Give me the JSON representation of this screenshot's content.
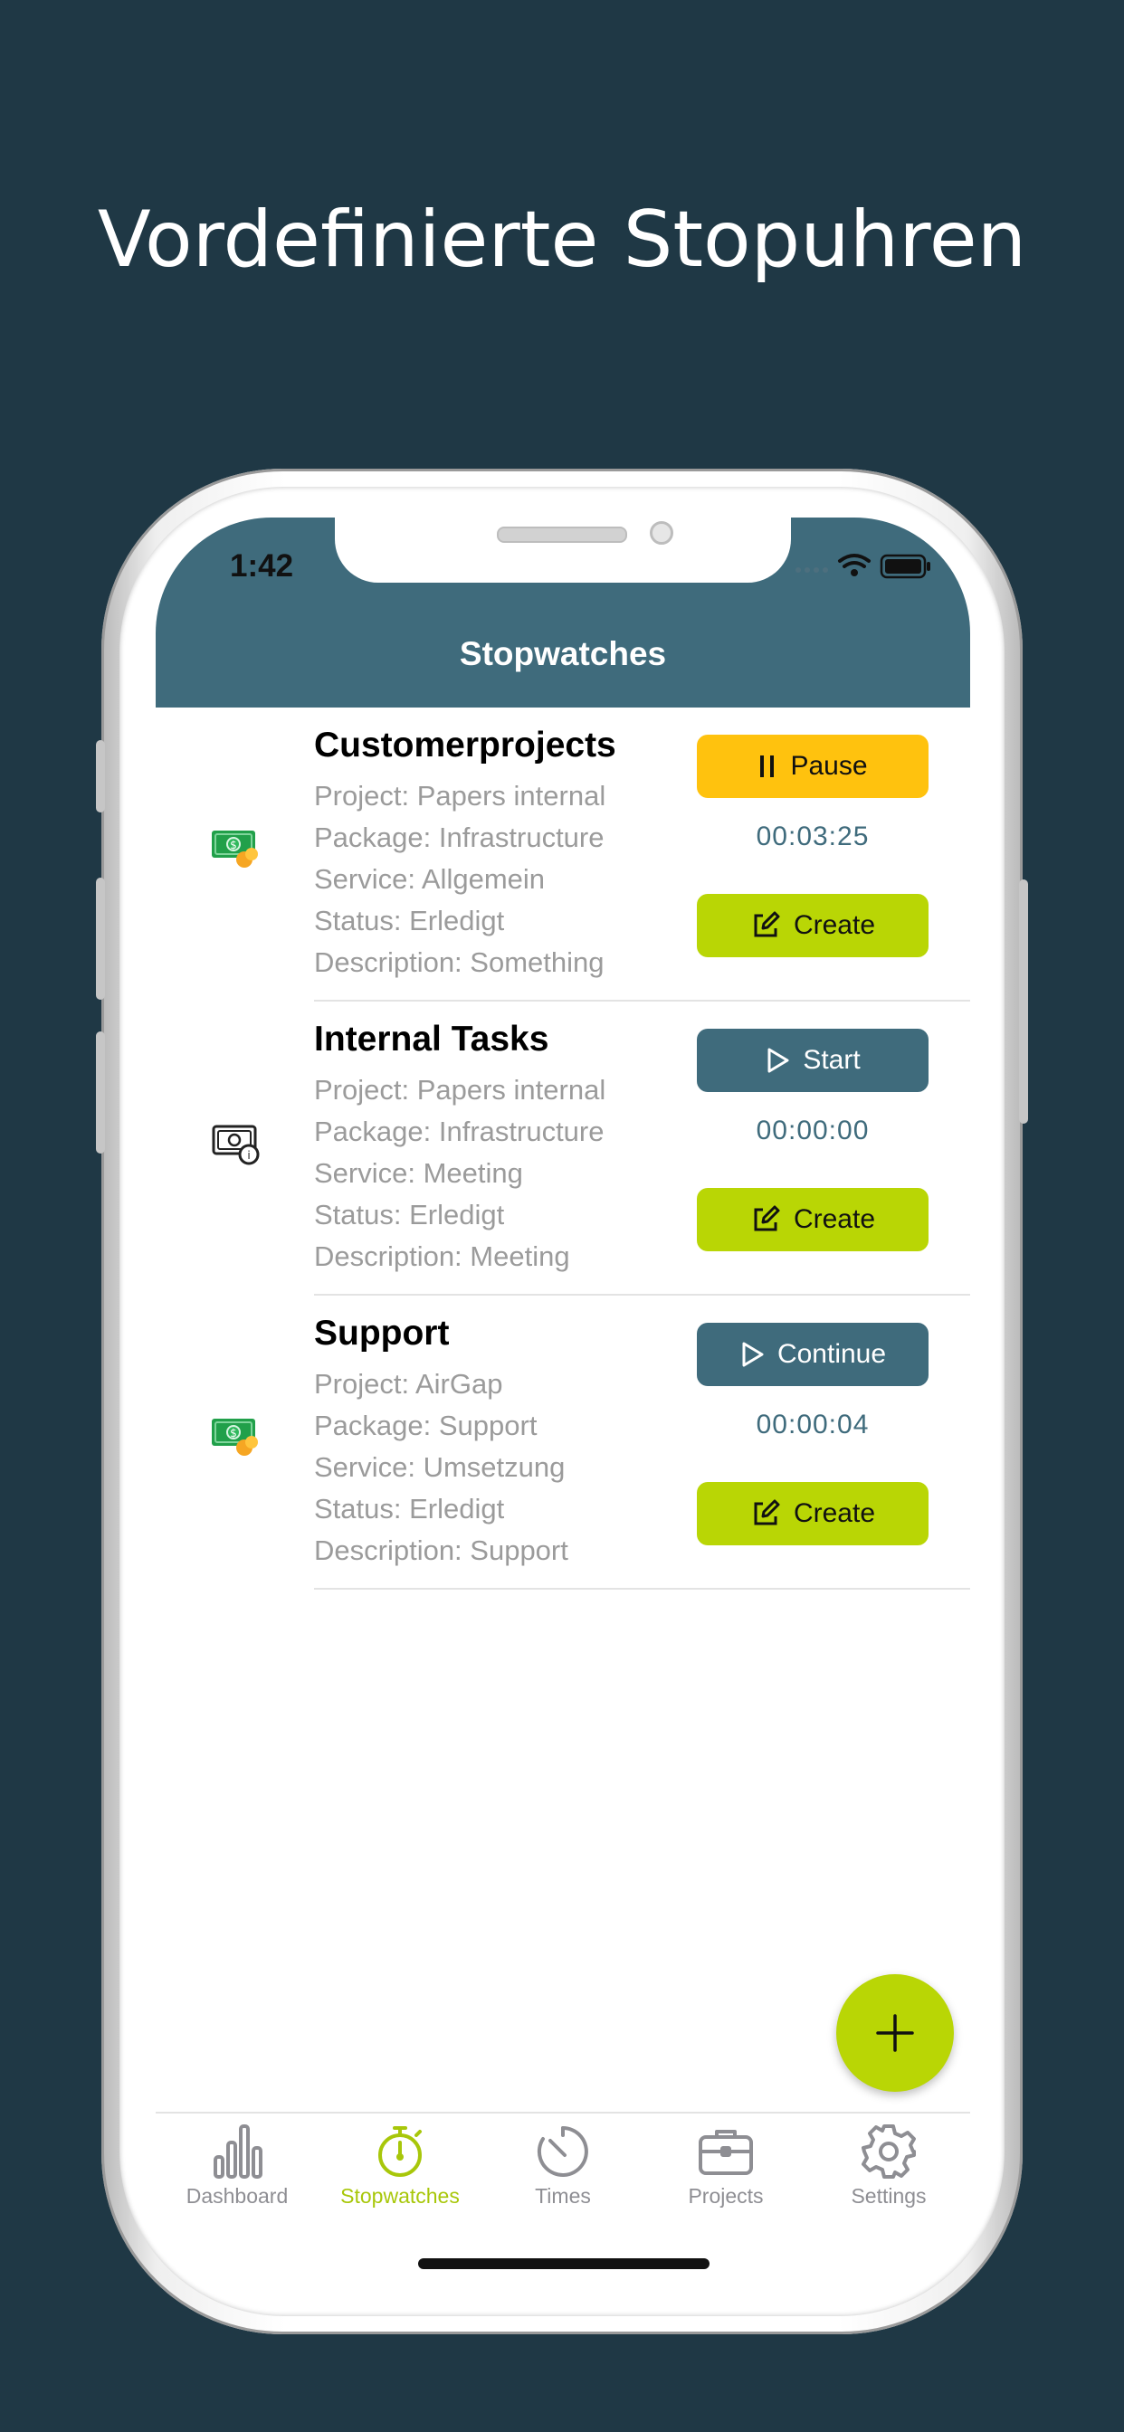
{
  "headline": "Vordefinierte Stopuhren",
  "status_bar": {
    "time": "1:42"
  },
  "nav": {
    "title": "Stopwatches"
  },
  "colors": {
    "background": "#1f3845",
    "nav": "#3f6b7c",
    "pause": "#ffc20e",
    "accent": "#b9d605",
    "timer": "#3f6b7c"
  },
  "stopwatches": [
    {
      "icon": "money-icon",
      "title": "Customerprojects",
      "project": "Project: Papers internal",
      "package": "Package: Infrastructure",
      "service": "Service: Allgemein",
      "status": "Status: Erledigt",
      "description": "Description: Something",
      "action_label": "Pause",
      "action_icon": "pause-icon",
      "timer": "00:03:25",
      "create_label": "Create"
    },
    {
      "icon": "internal-money-icon",
      "title": "Internal Tasks",
      "project": "Project: Papers internal",
      "package": "Package: Infrastructure",
      "service": "Service: Meeting",
      "status": "Status: Erledigt",
      "description": "Description: Meeting",
      "action_label": "Start",
      "action_icon": "play-icon",
      "timer": "00:00:00",
      "create_label": "Create"
    },
    {
      "icon": "money-icon",
      "title": "Support",
      "project": "Project: AirGap",
      "package": "Package: Support",
      "service": "Service: Umsetzung",
      "status": "Status: Erledigt",
      "description": "Description: Support",
      "action_label": "Continue",
      "action_icon": "play-icon",
      "timer": "00:00:04",
      "create_label": "Create"
    }
  ],
  "fab": {
    "icon": "plus-icon"
  },
  "tabs": [
    {
      "label": "Dashboard",
      "icon": "bar-chart-icon",
      "active": false
    },
    {
      "label": "Stopwatches",
      "icon": "stopwatch-icon",
      "active": true
    },
    {
      "label": "Times",
      "icon": "timer-dial-icon",
      "active": false
    },
    {
      "label": "Projects",
      "icon": "briefcase-icon",
      "active": false
    },
    {
      "label": "Settings",
      "icon": "gear-icon",
      "active": false
    }
  ]
}
